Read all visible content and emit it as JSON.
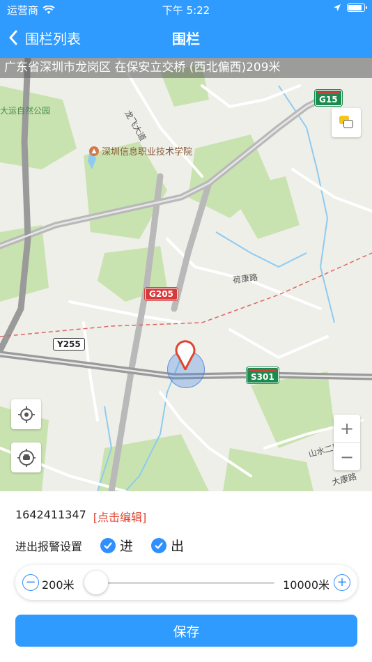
{
  "status_bar": {
    "carrier": "运营商",
    "time": "下午 5:22"
  },
  "nav": {
    "back_label": "围栏列表",
    "title": "围栏"
  },
  "map": {
    "address": "广东省深圳市龙岗区 在保安立交桥 (西北偏西)209米",
    "labels": {
      "park": "大运自然公园",
      "dafei": "龙飞大道",
      "school": "深圳信息职业技术学院",
      "hekang": "荷康路",
      "shanshui": "山水二路",
      "dakang": "大康路"
    },
    "shields": {
      "g15": "G15",
      "g205": "G205",
      "y255": "Y255",
      "s301": "S301"
    }
  },
  "fence": {
    "id": "1642411347",
    "edit_label": "[点击编辑]",
    "alarm_label": "进出报警设置",
    "enter_label": "进",
    "exit_label": "出",
    "enter_checked": true,
    "exit_checked": true
  },
  "radius": {
    "min_label": "200米",
    "max_label": "10000米",
    "value_fraction": 0
  },
  "save_label": "保存",
  "colors": {
    "primary": "#2f9bff",
    "edit": "#e0452f",
    "checkbox": "#2f8fff"
  },
  "icons": {
    "back": "chevron-left-icon",
    "layers": "layers-icon",
    "locate": "crosshair-icon",
    "car_locate": "car-locate-icon",
    "marker": "map-pin-icon",
    "zoom_in": "plus-icon",
    "zoom_out": "minus-icon"
  }
}
